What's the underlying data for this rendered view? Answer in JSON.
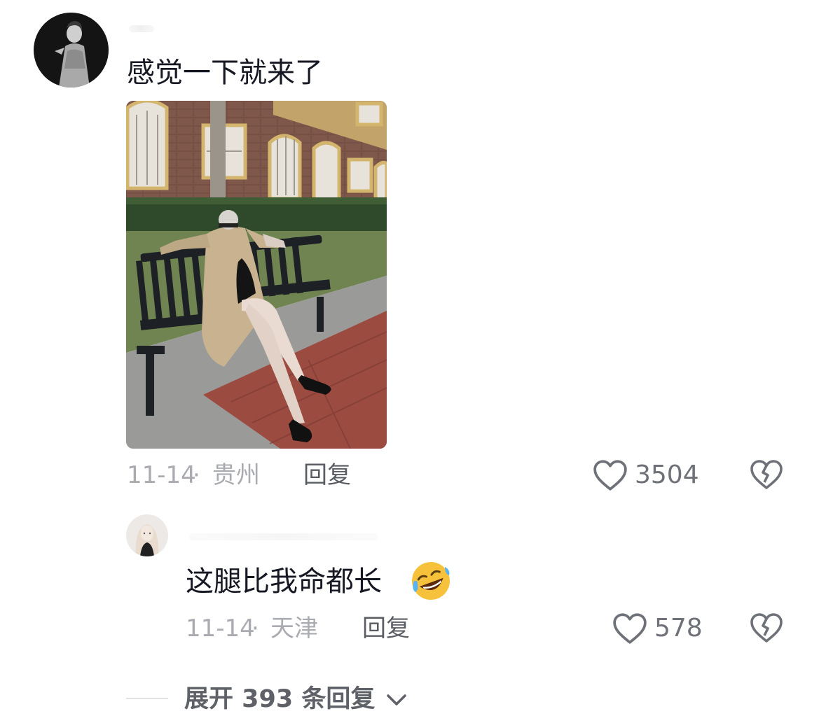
{
  "comment": {
    "text": "感觉一下就来了",
    "date": "11-14",
    "location": "贵州",
    "reply_label": "回复",
    "likes": "3504"
  },
  "reply": {
    "text": "这腿比我命都长",
    "emoji": "🤣",
    "date": "11-14",
    "location": "天津",
    "reply_label": "回复",
    "likes": "578"
  },
  "expand": {
    "label": "展开 393 条回复"
  },
  "icons": {
    "like": "heart-outline-icon",
    "dislike": "broken-heart-icon",
    "expand": "chevron-down-icon"
  },
  "colors": {
    "text_primary": "#161823",
    "text_meta": "#a9abb1",
    "icon_gray": "#6f7178"
  }
}
